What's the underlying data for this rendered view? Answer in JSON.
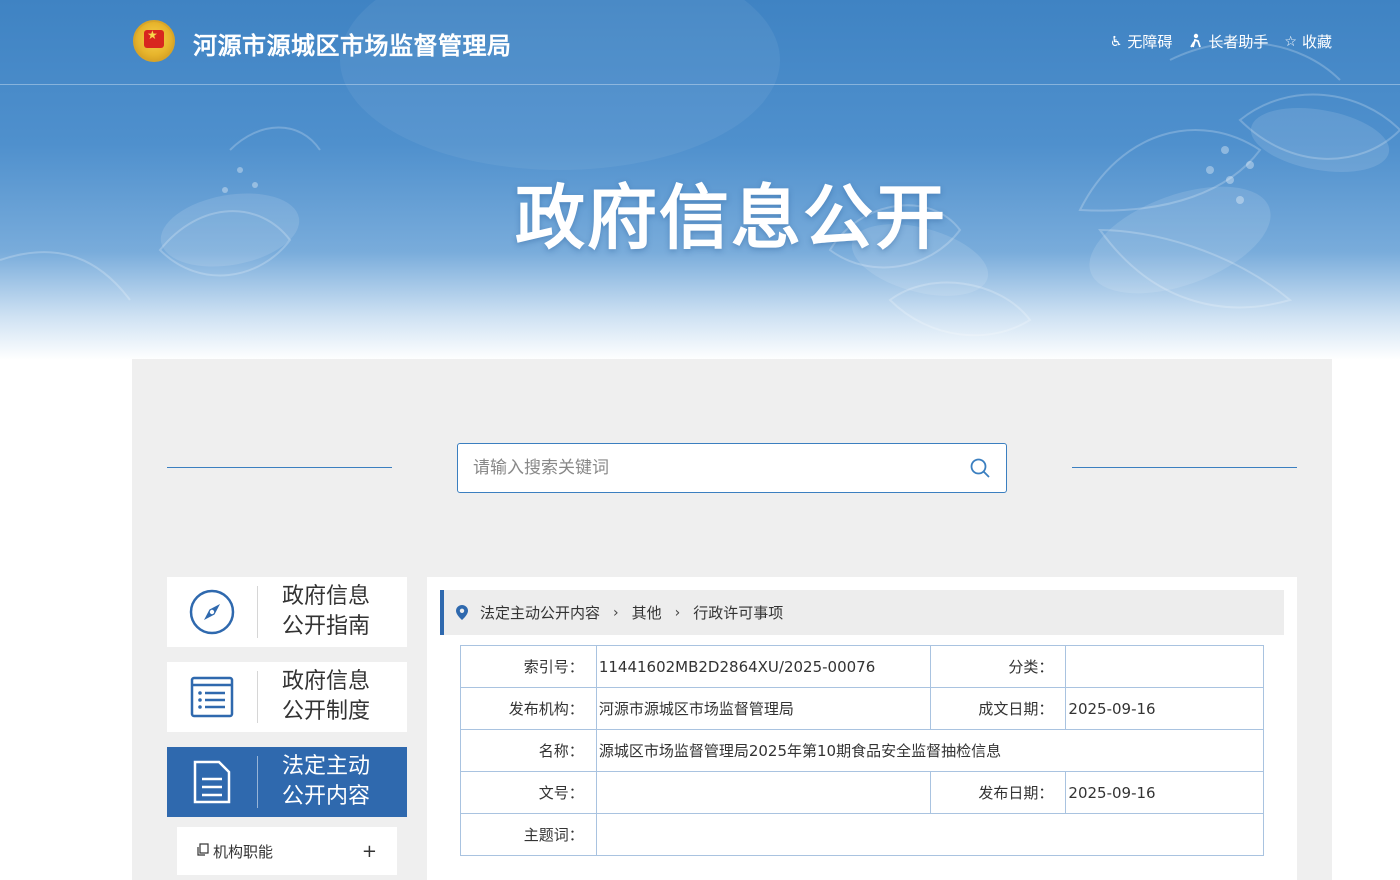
{
  "header": {
    "site_title": "河源市源城区市场监督管理局",
    "links": [
      {
        "label": "无障碍",
        "icon": "wheelchair-icon"
      },
      {
        "label": "长者助手",
        "icon": "elder-assist-icon"
      },
      {
        "label": "收藏",
        "icon": "star-icon"
      }
    ],
    "hero_title": "政府信息公开"
  },
  "search": {
    "placeholder": "请输入搜索关键词"
  },
  "sidebar": {
    "items": [
      {
        "line1": "政府信息",
        "line2": "公开指南",
        "icon": "compass-icon",
        "active": false
      },
      {
        "line1": "政府信息",
        "line2": "公开制度",
        "icon": "list-document-icon",
        "active": false
      },
      {
        "line1": "法定主动",
        "line2": "公开内容",
        "icon": "document-icon",
        "active": true
      }
    ],
    "sub_items": [
      {
        "label": "机构职能",
        "toggle": "+"
      }
    ]
  },
  "breadcrumb": [
    "法定主动公开内容",
    "其他",
    "行政许可事项"
  ],
  "info": {
    "index_label": "索引号：",
    "index_value": "11441602MB2D2864XU/2025-00076",
    "category_label": "分类：",
    "category_value": "",
    "publisher_label": "发布机构：",
    "publisher_value": "河源市源城区市场监督管理局",
    "created_label": "成文日期：",
    "created_value": "2025-09-16",
    "name_label": "名称：",
    "name_value": "源城区市场监督管理局2025年第10期食品安全监督抽检信息",
    "docno_label": "文号：",
    "docno_value": "",
    "published_label": "发布日期：",
    "published_value": "2025-09-16",
    "keywords_label": "主题词：",
    "keywords_value": ""
  },
  "colors": {
    "primary": "#2f69ae",
    "border": "#a9c3e0",
    "panel_bg": "#efefef"
  }
}
